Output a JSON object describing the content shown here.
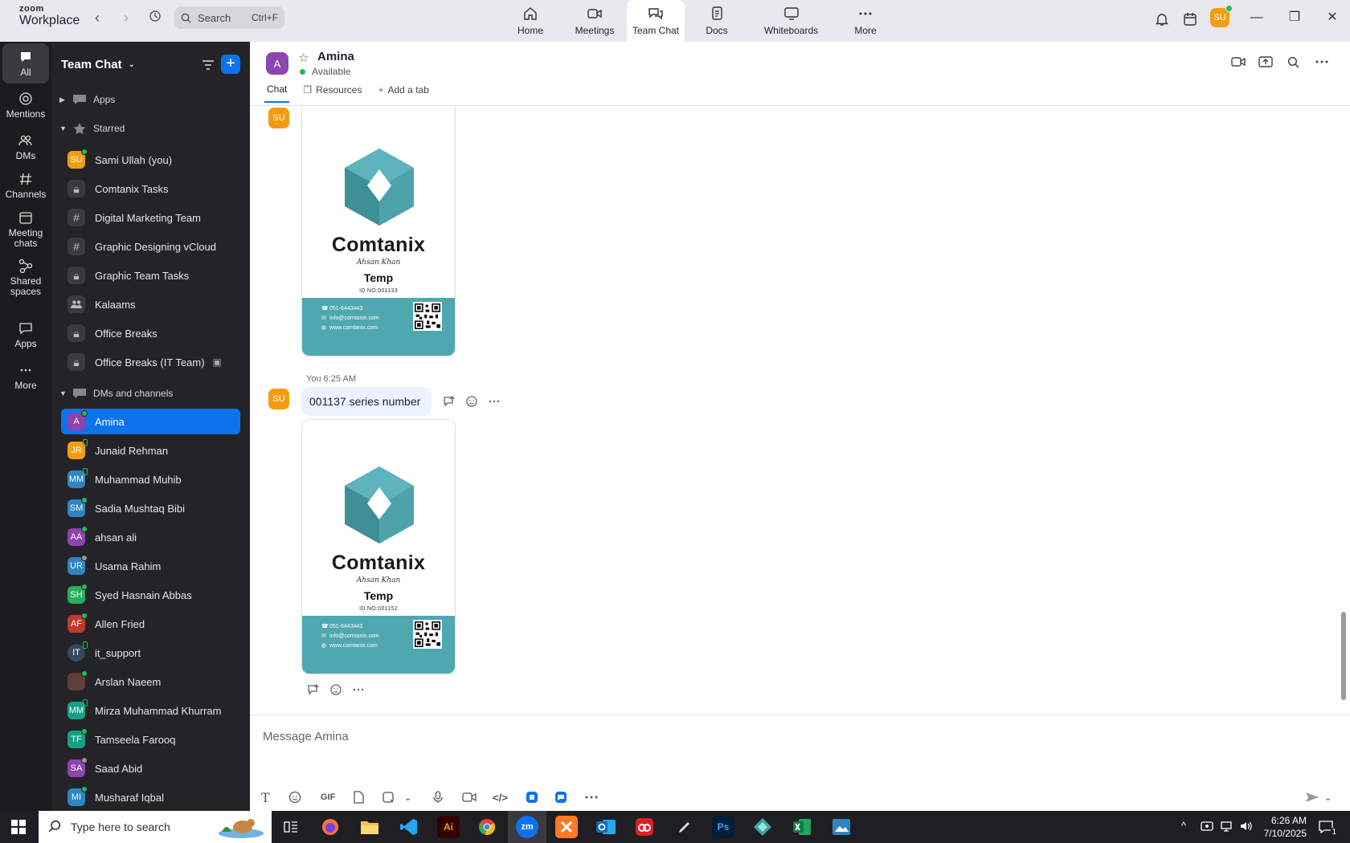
{
  "app": {
    "brand_top": "zoom",
    "brand_bottom": "Workplace"
  },
  "search": {
    "placeholder": "Search",
    "shortcut": "Ctrl+F"
  },
  "top_tabs": [
    {
      "label": "Home",
      "icon": "home-icon"
    },
    {
      "label": "Meetings",
      "icon": "video-camera-icon"
    },
    {
      "label": "Team Chat",
      "icon": "chat-bubbles-icon",
      "active": true
    },
    {
      "label": "Docs",
      "icon": "document-icon"
    },
    {
      "label": "Whiteboards",
      "icon": "whiteboard-icon"
    },
    {
      "label": "More",
      "icon": "more-dots-icon"
    }
  ],
  "user": {
    "initials": "SU",
    "color": "#f39c12"
  },
  "rail": [
    {
      "label": "All",
      "icon": "chat-icon",
      "active": true
    },
    {
      "label": "Mentions",
      "icon": "at-icon"
    },
    {
      "label": "DMs",
      "icon": "people-icon"
    },
    {
      "label": "Channels",
      "icon": "hash-icon"
    },
    {
      "label": "Meeting chats",
      "icon": "calendar-icon"
    },
    {
      "label": "Shared spaces",
      "icon": "shared-spaces-icon"
    },
    {
      "label": "Apps",
      "icon": "apps-chat-icon"
    },
    {
      "label": "More",
      "icon": "more-dots-icon"
    }
  ],
  "sidebar": {
    "title": "Team Chat",
    "sections": {
      "apps": "Apps",
      "starred": "Starred",
      "dms": "DMs and channels"
    },
    "starred": [
      {
        "label": "Sami Ullah (you)",
        "initials": "SU",
        "color": "#f39c12",
        "status": "online"
      },
      {
        "label": "Comtanix Tasks",
        "kind": "lock"
      },
      {
        "label": "Digital Marketing Team",
        "kind": "hash"
      },
      {
        "label": "Graphic Designing vCloud",
        "kind": "hash"
      },
      {
        "label": "Graphic Team Tasks",
        "kind": "lock"
      },
      {
        "label": "Kalaams",
        "kind": "group"
      },
      {
        "label": "Office Breaks",
        "kind": "lock"
      },
      {
        "label": "Office Breaks (IT Team)",
        "kind": "lock"
      }
    ],
    "dms": [
      {
        "label": "Amina",
        "initials": "A",
        "color": "#8e44ad",
        "status": "online",
        "active": true
      },
      {
        "label": "Junaid Rehman",
        "initials": "JR",
        "color": "#f39c12",
        "status": "mobile"
      },
      {
        "label": "Muhammad Muhib",
        "initials": "MM",
        "color": "#2e86c1",
        "status": "mobile"
      },
      {
        "label": "Sadia Mushtaq Bibi",
        "initials": "SM",
        "color": "#2e86c1",
        "status": "online"
      },
      {
        "label": "ahsan ali",
        "initials": "AA",
        "color": "#8e44ad",
        "status": "online"
      },
      {
        "label": "Usama Rahim",
        "initials": "UR",
        "color": "#2e86c1",
        "status": "away"
      },
      {
        "label": "Syed Hasnain Abbas",
        "initials": "SH",
        "color": "#27ae60",
        "status": "online"
      },
      {
        "label": "Allen Fried",
        "initials": "AF",
        "color": "#c0392b",
        "status": "online"
      },
      {
        "label": "it_support",
        "initials": "IT",
        "color": "#34495e",
        "status": "mobile"
      },
      {
        "label": "Arslan Naeem",
        "initials": "",
        "color": "#5d4037",
        "status": "online"
      },
      {
        "label": "Mirza Muhammad Khurram",
        "initials": "MM",
        "color": "#16a085",
        "status": "mobile"
      },
      {
        "label": "Tamseela Farooq",
        "initials": "TF",
        "color": "#16a085",
        "status": "online"
      },
      {
        "label": "Saad Abid",
        "initials": "SA",
        "color": "#8e44ad",
        "status": "away"
      },
      {
        "label": "Musharaf Iqbal",
        "initials": "MI",
        "color": "#2e86c1",
        "status": "online"
      }
    ]
  },
  "chat": {
    "contact_name": "Amina",
    "contact_initial": "A",
    "status": "Available",
    "tabs": [
      "Chat",
      "Resources",
      "Add a tab"
    ],
    "messages": {
      "card1": {
        "sender": "SU",
        "brand": "Comtanix",
        "signature": "Ahsan Khan",
        "role": "Temp",
        "id_no": "ID NO:001133",
        "phone": "051-6443443",
        "email": "info@comtanix.com",
        "web": "www.comtanix.com"
      },
      "text_meta": "You 6:25 AM",
      "text_sender": "SU",
      "text": "001137 series number",
      "card2": {
        "brand": "Comtanix",
        "signature": "Ahsan Khan",
        "role": "Temp",
        "id_no": "ID NO:001152",
        "phone": "051-6443443",
        "email": "info@comtanix.com",
        "web": "www.comtanix.com"
      }
    },
    "composer_placeholder": "Message Amina",
    "composer_gif": "GIF"
  },
  "taskbar": {
    "search_placeholder": "Type here to search",
    "time": "6:26 AM",
    "date": "7/10/2025",
    "notification_count": "1",
    "apps": [
      {
        "name": "task-view",
        "label": ""
      },
      {
        "name": "firefox",
        "color": "#ff7139"
      },
      {
        "name": "file-explorer",
        "color": "#f5c542"
      },
      {
        "name": "vscode",
        "color": "#0e72ed"
      },
      {
        "name": "illustrator",
        "label": "Ai",
        "color": "#330000"
      },
      {
        "name": "chrome",
        "color": "#34a853"
      },
      {
        "name": "zoom",
        "label": "zm",
        "color": "#0e72ed",
        "active": true
      },
      {
        "name": "xampp",
        "color": "#fb7a24"
      },
      {
        "name": "outlook",
        "color": "#0f6cbd"
      },
      {
        "name": "creative-cloud",
        "color": "#da1f26"
      },
      {
        "name": "pen-tool",
        "color": "#444"
      },
      {
        "name": "photoshop",
        "label": "Ps",
        "color": "#001e36"
      },
      {
        "name": "app-diamond",
        "color": "#3aa6a6"
      },
      {
        "name": "excel",
        "color": "#1d6f42"
      },
      {
        "name": "paint",
        "color": "#2e86c1"
      }
    ]
  }
}
